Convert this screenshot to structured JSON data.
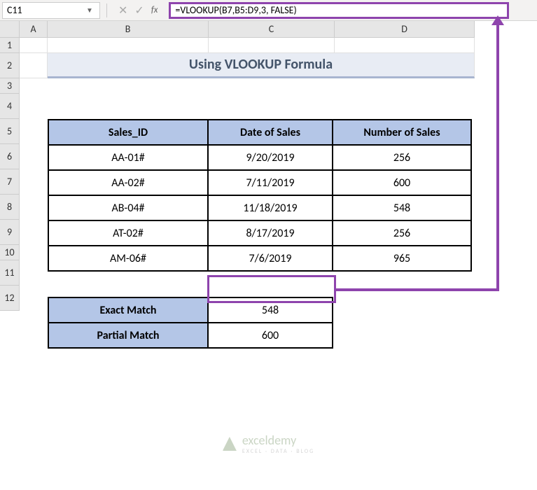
{
  "nameBox": "C11",
  "formula": "=VLOOKUP(B7,B5:D9,3, FALSE)",
  "fxLabel": "fx",
  "columns": [
    "A",
    "B",
    "C",
    "D"
  ],
  "rows": [
    "1",
    "2",
    "3",
    "4",
    "5",
    "6",
    "7",
    "8",
    "9",
    "10",
    "11",
    "12"
  ],
  "title": "Using VLOOKUP Formula",
  "table": {
    "headers": [
      "Sales_ID",
      "Date of Sales",
      "Number of Sales"
    ],
    "rows": [
      [
        "AA-01#",
        "9/20/2019",
        "256"
      ],
      [
        "AA-02#",
        "7/11/2019",
        "600"
      ],
      [
        "AB-04#",
        "11/18/2019",
        "548"
      ],
      [
        "AT-02#",
        "8/17/2019",
        "256"
      ],
      [
        "AM-06#",
        "7/6/2019",
        "965"
      ]
    ]
  },
  "matches": [
    {
      "label": "Exact Match",
      "value": "548"
    },
    {
      "label": "Partial Match",
      "value": "600"
    }
  ],
  "watermark": {
    "brand": "exceldemy",
    "tagline": "EXCEL · DATA · BLOG"
  }
}
